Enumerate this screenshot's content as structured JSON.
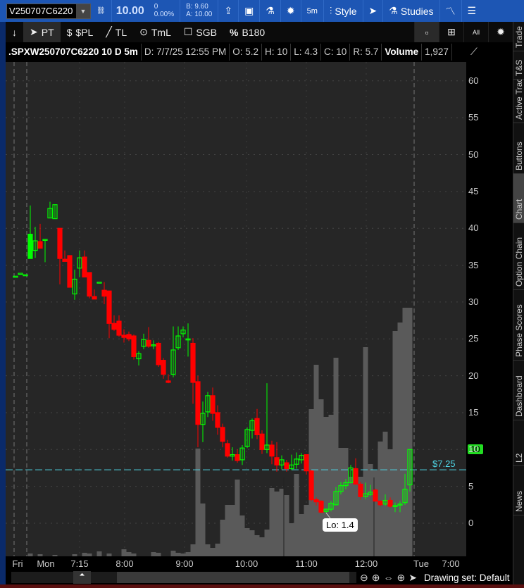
{
  "topbar": {
    "symbol": "V250707C6220",
    "last": "10.00",
    "change": "0",
    "change_pct": "0.00%",
    "bid": "B: 9.60",
    "ask": "A: 10.00",
    "aggregation": "5m",
    "style_label": "Style",
    "studies_label": "Studies"
  },
  "tools": {
    "items": [
      {
        "label": "PT",
        "icon": "cursor-icon"
      },
      {
        "label": "$PL",
        "icon": "dollar-icon"
      },
      {
        "label": "TL",
        "icon": "trendline-icon"
      },
      {
        "label": "TmL",
        "icon": "timeline-icon"
      },
      {
        "label": "SGB",
        "icon": "square-icon"
      },
      {
        "label": "B180",
        "icon": "percent-icon"
      }
    ],
    "all_label": "All"
  },
  "info": {
    "symbol": ".SPXW250707C6220 10 D 5m",
    "date": "D: 7/7/25 12:55 PM",
    "open": "O: 5.2",
    "high": "H: 10",
    "low": "L: 4.3",
    "close": "C: 10",
    "range": "R: 5.7",
    "volume_label": "Volume",
    "volume": "1,927"
  },
  "price_axis": {
    "labels": [
      "60",
      "55",
      "50",
      "45",
      "40",
      "35",
      "30",
      "25",
      "20",
      "15",
      "10",
      "5",
      "0"
    ],
    "current_tag": "10"
  },
  "time_axis": {
    "labels": [
      "Fri",
      "Mon",
      "7:15",
      "8:00",
      "9:00",
      "10:00",
      "11:00",
      "12:00",
      "Tue",
      "7:00"
    ]
  },
  "annotations": {
    "low_label": "Lo: 1.4",
    "price_line_label": "$7.25",
    "price_line": 7.25
  },
  "bottom": {
    "drawing_set": "Drawing set: Default"
  },
  "right_tabs": [
    "Trade",
    "T&S",
    "Active Trader",
    "Buttons",
    "Chart",
    "Option Chain",
    "Phase Scores",
    "Dashboard",
    "L2",
    "News"
  ],
  "colors": {
    "up": "#00ff00",
    "down": "#ff0000",
    "volume": "#5a5a5a",
    "price_line": "#4fd8e8",
    "toolbar": "#1d56b4"
  },
  "chart_data": {
    "type": "candlestick",
    "bar_minutes": 5,
    "ylim": [
      -5,
      63
    ],
    "candles": [
      [
        -34,
        33.5,
        33.5,
        33.5,
        33.5
      ],
      [
        -33,
        33.9,
        33.9,
        33.9,
        33.9
      ],
      [
        -32,
        33.7,
        33.7,
        33.7,
        33.7
      ],
      [
        -31,
        35.9,
        43.1,
        36,
        39.2
      ],
      [
        -30,
        37,
        40.2,
        36,
        38.3
      ],
      [
        -29,
        38.2,
        40.6,
        37.3,
        37.3
      ],
      [
        -28,
        38.5,
        38.5,
        35.4,
        38.5
      ],
      [
        -27,
        41.4,
        43.6,
        41.4,
        42.7
      ],
      [
        -26,
        41.3,
        43.2,
        41.3,
        43.2
      ],
      [
        -25,
        40,
        40,
        32.4,
        35.9
      ],
      [
        -24,
        35.8,
        37,
        35.5,
        35.5
      ],
      [
        -23,
        36.3,
        36.3,
        32,
        32
      ],
      [
        -22,
        31.1,
        34.4,
        30.3,
        33.1
      ],
      [
        -21,
        34.6,
        37,
        33.4,
        36
      ],
      [
        -20,
        36.1,
        37,
        33.4,
        33.4
      ],
      [
        -19,
        34,
        34,
        30.5,
        30.8
      ],
      [
        -18,
        30.75,
        31.7,
        30.4,
        30.4
      ],
      [
        -17,
        32.7,
        32.7,
        32.7,
        32.7
      ],
      [
        -16,
        31.6,
        32.7,
        29.7,
        30.8
      ],
      [
        -15,
        31.5,
        31.5,
        25.1,
        27.1
      ],
      [
        -14,
        27.1,
        28.2,
        26.1,
        26.3
      ],
      [
        -13,
        27.4,
        28.2,
        25.3,
        25.5
      ],
      [
        -12,
        25.5,
        26.3,
        24.5,
        25.2
      ],
      [
        -11,
        25.6,
        26,
        24.7,
        25
      ],
      [
        -10,
        25.4,
        25.6,
        22.2,
        22.6
      ],
      [
        -9,
        22.3,
        23.3,
        21.4,
        23
      ],
      [
        -8,
        24,
        25.7,
        23.6,
        24.9
      ],
      [
        -7,
        24.8,
        26.6,
        23.8,
        24
      ],
      [
        -6,
        24.2,
        24.8,
        23.6,
        24.2
      ],
      [
        -5,
        24.4,
        24.6,
        21.2,
        21.5
      ],
      [
        -4,
        22.1,
        22.4,
        19.6,
        20.2
      ],
      [
        -3,
        19.3,
        20.2,
        19,
        19.1
      ],
      [
        -2,
        20.2,
        26.7,
        19.8,
        23.5
      ],
      [
        -1,
        23.8,
        26.7,
        23.5,
        25.4
      ],
      [
        0,
        25.7,
        26.7,
        25.2,
        26.2
      ],
      [
        1,
        25,
        27.1,
        22.6,
        25
      ],
      [
        2,
        24.4,
        25.1,
        16.2,
        19.1
      ],
      [
        3,
        19.2,
        20,
        10.3,
        13.4
      ],
      [
        4,
        13.4,
        16.5,
        11,
        14.9
      ],
      [
        5,
        15.1,
        17.8,
        14.4,
        17.3
      ],
      [
        6,
        17.3,
        18.4,
        13.9,
        14.9
      ],
      [
        7,
        15,
        16,
        12,
        13
      ],
      [
        8,
        13,
        13.5,
        10.3,
        11.1
      ],
      [
        9,
        10.8,
        11.3,
        8.9,
        9.1
      ],
      [
        10,
        9.1,
        10.3,
        8.5,
        9.3
      ],
      [
        11,
        9.3,
        10,
        8.2,
        8.5
      ],
      [
        12,
        8.6,
        10.6,
        7.9,
        10.2
      ],
      [
        13,
        10.4,
        13,
        10.2,
        12.7
      ],
      [
        14,
        12.6,
        14.2,
        11.5,
        13.9
      ],
      [
        15,
        14.2,
        15.5,
        11.4,
        12
      ],
      [
        16,
        12.1,
        12.6,
        9.4,
        10
      ],
      [
        17,
        10,
        19,
        9.5,
        10.6
      ],
      [
        18,
        10.6,
        11.2,
        8,
        9.1
      ],
      [
        19,
        8.9,
        11,
        7,
        7.9
      ],
      [
        20,
        7.9,
        9.2,
        7.3,
        8.6
      ],
      [
        21,
        8.2,
        8.6,
        7,
        7.4
      ],
      [
        22,
        7.4,
        9.3,
        7.2,
        7.9
      ],
      [
        23,
        8,
        9.6,
        7.4,
        8.7
      ],
      [
        24,
        8.6,
        9.5,
        8.1,
        9.2
      ],
      [
        25,
        9.3,
        9.3,
        6.6,
        7.1
      ],
      [
        26,
        7.1,
        7.2,
        3,
        3.2
      ],
      [
        27,
        3.2,
        3.5,
        2.4,
        2.9
      ],
      [
        28,
        3,
        3.1,
        1.4,
        1.5
      ],
      [
        29,
        1.6,
        2,
        1.4,
        1.9
      ],
      [
        30,
        1.9,
        3,
        1.6,
        2.7
      ],
      [
        31,
        2.5,
        4.9,
        2.4,
        4.3
      ],
      [
        32,
        4.3,
        5.6,
        3.9,
        5.1
      ],
      [
        33,
        5.1,
        6,
        4.6,
        5.5
      ],
      [
        34,
        5.5,
        7.9,
        5.4,
        7.5
      ],
      [
        35,
        7.4,
        8.8,
        5.2,
        5.3
      ],
      [
        36,
        5.3,
        5.6,
        3.2,
        3.6
      ],
      [
        37,
        3.6,
        5.5,
        3.3,
        4
      ],
      [
        38,
        3.9,
        5.2,
        3.7,
        4.2
      ],
      [
        39,
        4.5,
        4.7,
        2.9,
        3
      ],
      [
        40,
        3,
        3.1,
        2.3,
        2.5
      ],
      [
        41,
        2.6,
        3.9,
        2.4,
        3.1
      ],
      [
        42,
        3.1,
        3.5,
        2.1,
        2.3
      ],
      [
        43,
        2.3,
        2.8,
        1.5,
        2.4
      ],
      [
        44,
        2.5,
        3,
        1.5,
        2.6
      ],
      [
        45,
        2.8,
        6.7,
        2.5,
        4.6
      ],
      [
        46,
        5.2,
        10,
        4.3,
        10
      ]
    ],
    "volume": [
      [
        -31,
        4
      ],
      [
        -29,
        3
      ],
      [
        -26,
        2
      ],
      [
        -22,
        3
      ],
      [
        -20,
        5
      ],
      [
        -19,
        4
      ],
      [
        -17,
        7
      ],
      [
        -15,
        4
      ],
      [
        -12,
        10
      ],
      [
        -11,
        6
      ],
      [
        -10,
        4
      ],
      [
        -6,
        6
      ],
      [
        -5,
        5
      ],
      [
        -2,
        8
      ],
      [
        -1,
        5
      ],
      [
        0,
        4
      ],
      [
        1,
        6
      ],
      [
        2,
        17
      ],
      [
        3,
        153
      ],
      [
        4,
        75
      ],
      [
        5,
        17
      ],
      [
        6,
        12
      ],
      [
        7,
        18
      ],
      [
        8,
        52
      ],
      [
        9,
        73
      ],
      [
        10,
        73
      ],
      [
        11,
        109
      ],
      [
        12,
        58
      ],
      [
        13,
        40
      ],
      [
        14,
        37
      ],
      [
        15,
        30
      ],
      [
        16,
        27
      ],
      [
        17,
        38
      ],
      [
        18,
        97
      ],
      [
        19,
        92
      ],
      [
        20,
        96
      ],
      [
        21,
        87
      ],
      [
        22,
        47
      ],
      [
        23,
        117
      ],
      [
        24,
        60
      ],
      [
        25,
        73
      ],
      [
        26,
        209
      ],
      [
        27,
        272
      ],
      [
        28,
        223
      ],
      [
        29,
        198
      ],
      [
        30,
        201
      ],
      [
        31,
        282
      ],
      [
        32,
        154
      ],
      [
        33,
        154
      ],
      [
        34,
        113
      ],
      [
        35,
        113
      ],
      [
        36,
        113
      ],
      [
        37,
        297
      ],
      [
        38,
        131
      ],
      [
        39,
        122
      ],
      [
        40,
        163
      ],
      [
        41,
        177
      ],
      [
        42,
        152
      ],
      [
        43,
        320
      ],
      [
        44,
        332
      ],
      [
        45,
        353
      ],
      [
        46,
        353
      ]
    ]
  }
}
